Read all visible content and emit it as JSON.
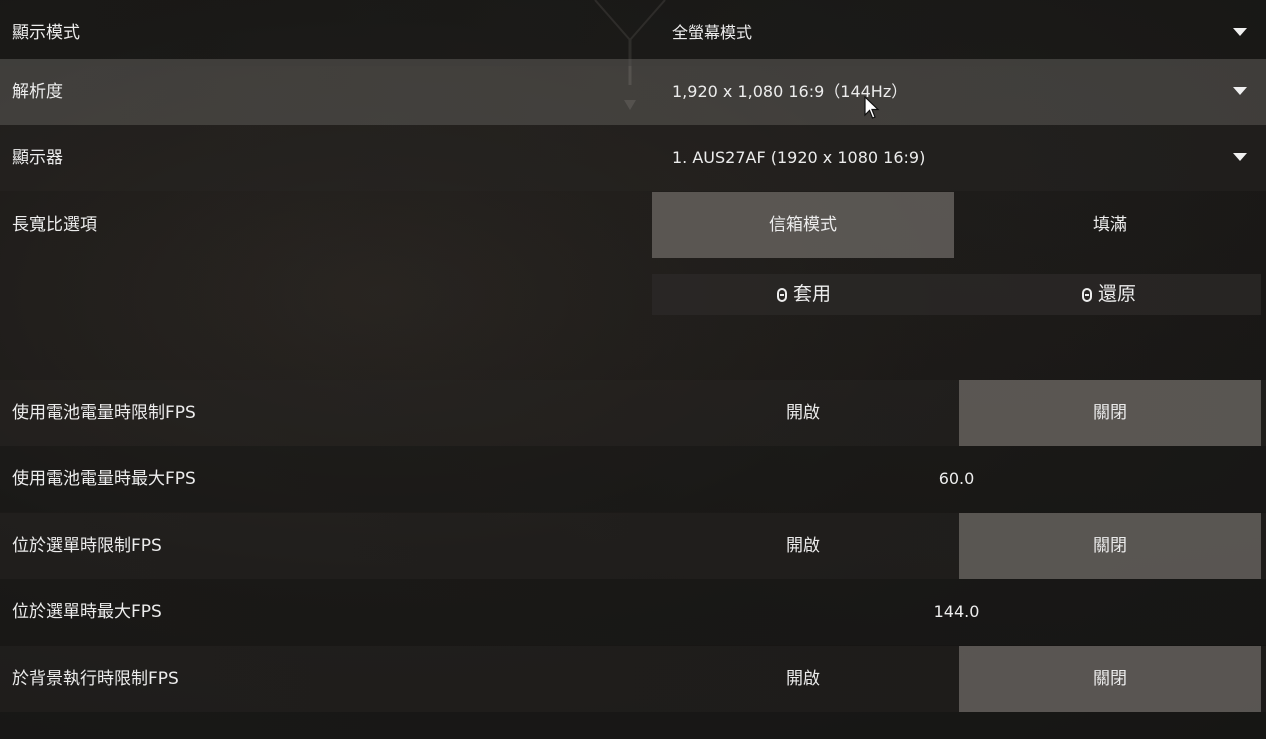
{
  "settings": {
    "display_mode": {
      "label": "顯示模式",
      "value": "全螢幕模式"
    },
    "resolution": {
      "label": "解析度",
      "value": "1,920 x 1,080 16:9（144Hz）"
    },
    "monitor": {
      "label": "顯示器",
      "value": "1. AUS27AF (1920 x  1080 16:9)"
    },
    "aspect_ratio": {
      "label": "長寬比選項",
      "options": [
        "信箱模式",
        "填滿"
      ],
      "selected": "信箱模式"
    },
    "actions": {
      "apply_label": "套用",
      "revert_label": "還原"
    },
    "battery_fps_limit": {
      "label": "使用電池電量時限制FPS",
      "on_label": "開啟",
      "off_label": "關閉",
      "selected": "關閉"
    },
    "battery_max_fps": {
      "label": "使用電池電量時最大FPS",
      "value": "60.0"
    },
    "menu_fps_limit": {
      "label": "位於選單時限制FPS",
      "on_label": "開啟",
      "off_label": "關閉",
      "selected": "關閉"
    },
    "menu_max_fps": {
      "label": "位於選單時最大FPS",
      "value": "144.0"
    },
    "background_fps_limit": {
      "label": "於背景執行時限制FPS",
      "on_label": "開啟",
      "off_label": "關閉",
      "selected": "關閉"
    }
  },
  "icons": {
    "dropdown": "chevron-down-icon",
    "key": "key-icon",
    "cursor": "mouse-cursor-icon"
  },
  "colors": {
    "text": "#ececec",
    "selected_segment": "#706c68",
    "row_highlight": "#5f5c59"
  }
}
